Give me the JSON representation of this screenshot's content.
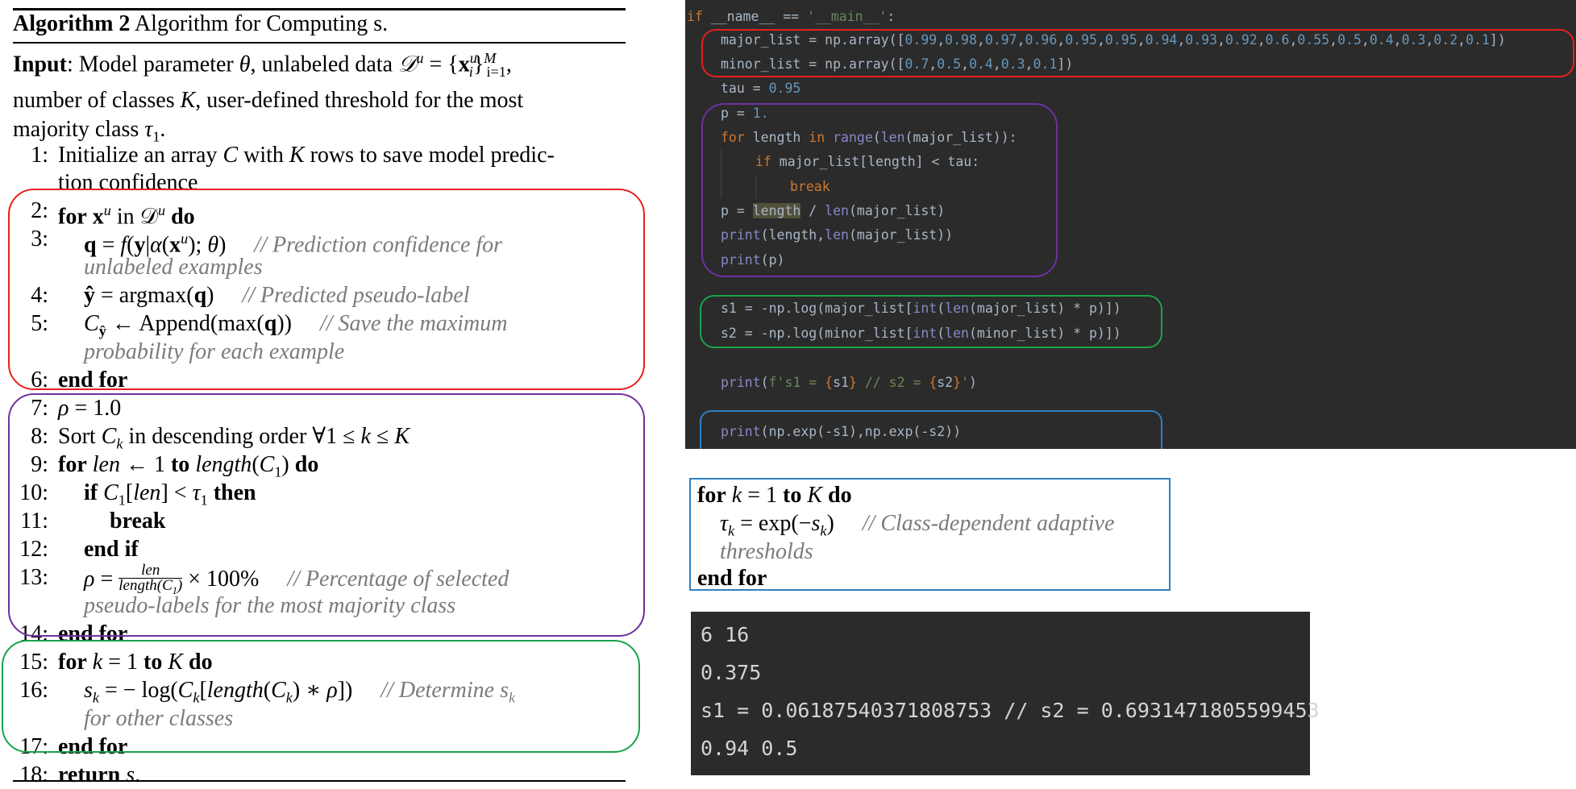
{
  "algorithm": {
    "label": "Algorithm 2",
    "title": "Algorithm for Computing s.",
    "input_label": "Input",
    "input_line1": "Model parameter θ, unlabeled data 𝒟",
    "input_line1b": "= {x",
    "input_line1c": "}",
    "input_line2": "number of classes K, user-defined threshold for the most",
    "input_line3": "majority class τ",
    "lines": [
      {
        "num": "1:",
        "text": "Initialize an array C with K rows to save model predic-"
      },
      {
        "num": "",
        "text": "tion confidence"
      },
      {
        "num": "2:",
        "text": "for x^u in D^u do"
      },
      {
        "num": "3:",
        "text": "q = f(y|α(x^u); θ)",
        "comment": "// Prediction confidence for"
      },
      {
        "num": "",
        "comment": "unlabeled examples"
      },
      {
        "num": "4:",
        "text": "ŷ = argmax(q)",
        "comment": "// Predicted pseudo-label"
      },
      {
        "num": "5:",
        "text": "C_ŷ ← Append(max(q))",
        "comment": "// Save the maximum"
      },
      {
        "num": "",
        "comment": "probability for each example"
      },
      {
        "num": "6:",
        "text": "end for"
      },
      {
        "num": "7:",
        "text": "ρ = 1.0"
      },
      {
        "num": "8:",
        "text": "Sort C_k in descending order ∀1 ≤ k ≤ K"
      },
      {
        "num": "9:",
        "text": "for len ← 1 to length(C_1) do"
      },
      {
        "num": "10:",
        "text": "if C_1[len] < τ_1 then"
      },
      {
        "num": "11:",
        "text": "break"
      },
      {
        "num": "12:",
        "text": "end if"
      },
      {
        "num": "13:",
        "text": "ρ = len / length(C_1) × 100%",
        "comment": "// Percentage of selected"
      },
      {
        "num": "",
        "comment": "pseudo-labels for the most majority class"
      },
      {
        "num": "14:",
        "text": "end for"
      },
      {
        "num": "15:",
        "text": "for k = 1 to K do"
      },
      {
        "num": "16:",
        "text": "s_k = − log(C_k[length(C_k) ∗ ρ])",
        "comment": "// Determine s_k"
      },
      {
        "num": "",
        "comment": "for other classes"
      },
      {
        "num": "17:",
        "text": "end for"
      },
      {
        "num": "18:",
        "text": "return s."
      }
    ]
  },
  "code": {
    "lines": [
      "if __name__ == '__main__':",
      "    major_list = np.array([0.99,0.98,0.97,0.96,0.95,0.95,0.94,0.93,0.92,0.6,0.55,0.5,0.4,0.3,0.2,0.1])",
      "    minor_list = np.array([0.7,0.5,0.4,0.3,0.1])",
      "    tau = 0.95",
      "    p = 1.",
      "    for length in range(len(major_list)):",
      "        if major_list[length] < tau:",
      "            break",
      "    p = length / len(major_list)",
      "    print(length,len(major_list))",
      "    print(p)",
      "",
      "    s1 = -np.log(major_list[int(len(major_list) * p)])",
      "    s2 = -np.log(minor_list[int(len(minor_list) * p)])",
      "",
      "    print(f's1 = {s1} // s2 = {s2}')",
      "",
      "    print(np.exp(-s1),np.exp(-s2))"
    ]
  },
  "for_box": {
    "line1": "for k = 1 to K do",
    "line2": "τ_k = exp(−s_k)",
    "comment1": "// Class-dependent adaptive",
    "comment2": "thresholds",
    "line3": "end for"
  },
  "output": {
    "lines": [
      "6 16",
      "0.375",
      "s1 = 0.06187540371808753 // s2 = 0.6931471805599453",
      "0.94 0.5"
    ]
  },
  "colors": {
    "red_box": "#e8201c",
    "purple_box": "#7030a0",
    "green_box": "#1aa34a",
    "blue_box": "#2f80c4",
    "code_bg": "#2b2b2b"
  }
}
